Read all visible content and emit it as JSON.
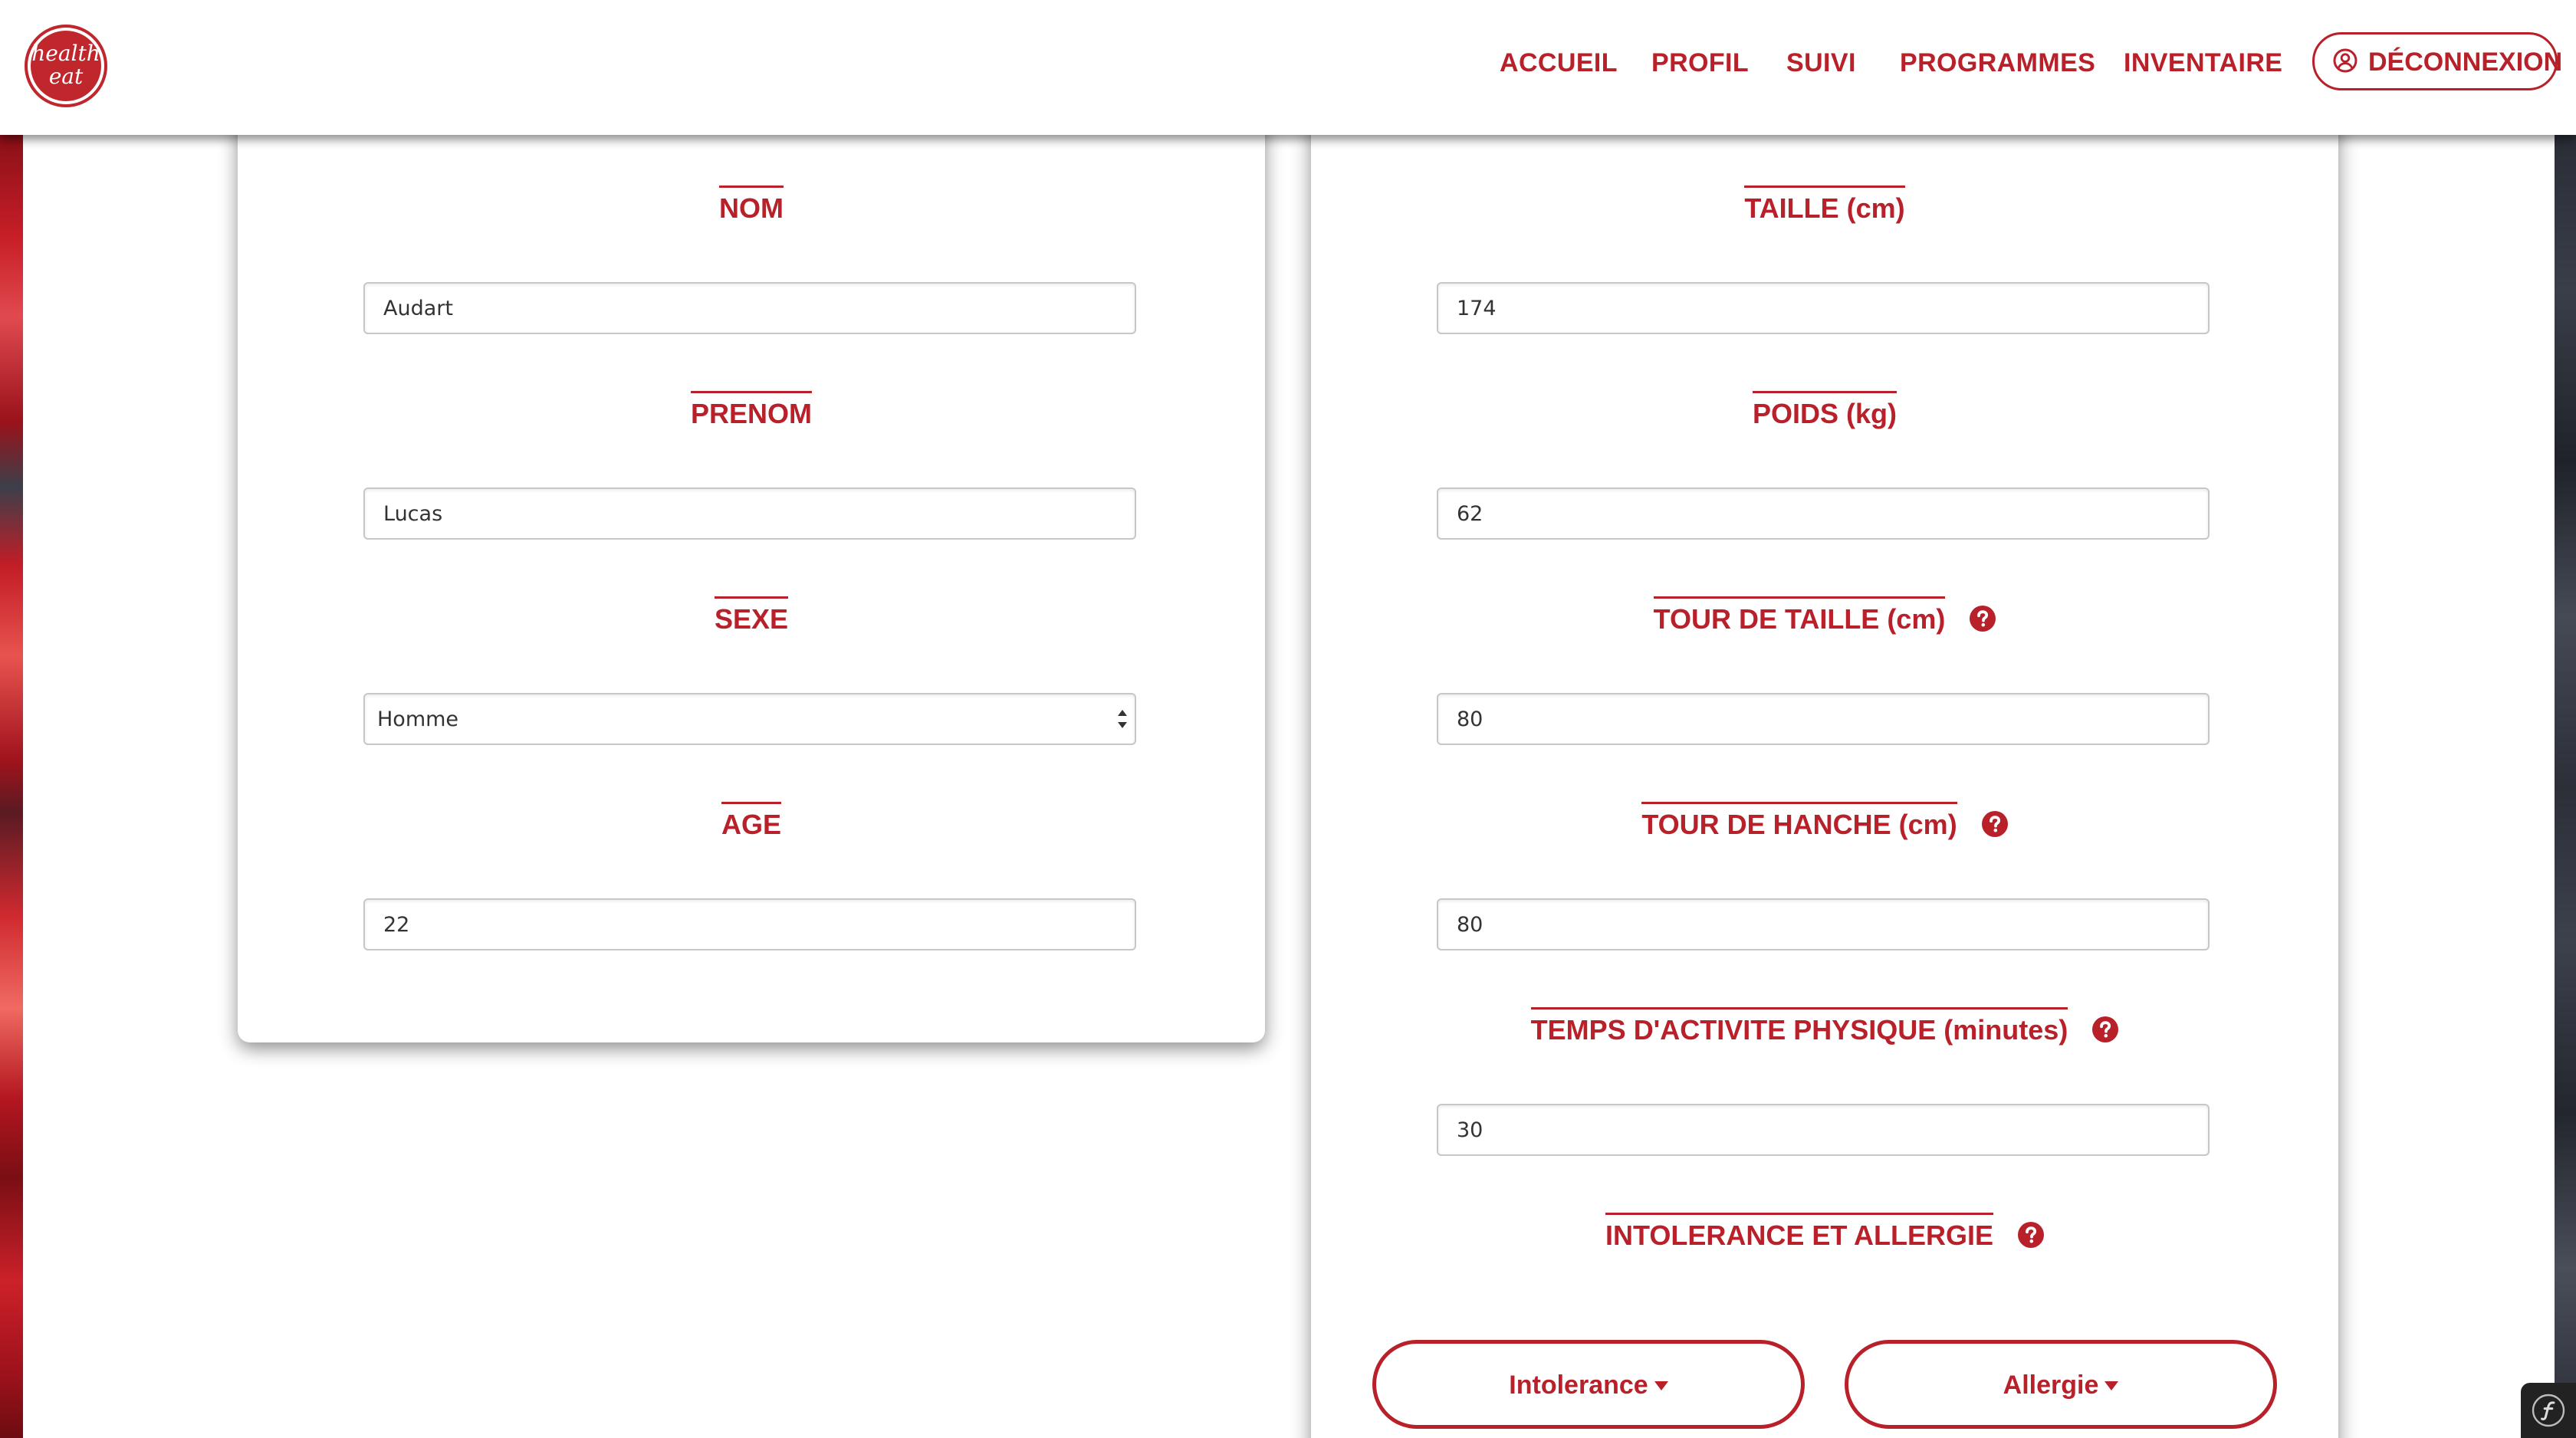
{
  "brand": {
    "logo_line1": "health",
    "logo_line2": "eat",
    "color": "#b8202a"
  },
  "nav": {
    "items": [
      {
        "label": "ACCUEIL"
      },
      {
        "label": "PROFIL"
      },
      {
        "label": "SUIVI"
      },
      {
        "label": "PROGRAMMES"
      },
      {
        "label": "INVENTAIRE"
      }
    ],
    "logout_label": "DÉCONNEXION",
    "logout_icon": "user-circle-icon"
  },
  "identity_form": {
    "nom": {
      "label": "NOM",
      "value": "Audart"
    },
    "prenom": {
      "label": "PRENOM",
      "value": "Lucas"
    },
    "sexe": {
      "label": "SEXE",
      "value": "Homme"
    },
    "age": {
      "label": "AGE",
      "value": "22"
    }
  },
  "body_form": {
    "taille": {
      "label": "TAILLE (cm)",
      "value": "174"
    },
    "poids": {
      "label": "POIDS (kg)",
      "value": "62"
    },
    "tour_taille": {
      "label": "TOUR DE TAILLE (cm)",
      "value": "80",
      "help_icon": "question-circle-icon"
    },
    "tour_hanche": {
      "label": "TOUR DE HANCHE (cm)",
      "value": "80",
      "help_icon": "question-circle-icon"
    },
    "activite": {
      "label": "TEMPS D'ACTIVITE PHYSIQUE (minutes)",
      "value": "30",
      "help_icon": "question-circle-icon"
    },
    "intolerance_allergie": {
      "label": "INTOLERANCE ET ALLERGIE",
      "help_icon": "question-circle-icon"
    }
  },
  "buttons": {
    "intolerance": "Intolerance",
    "allergie": "Allergie"
  },
  "debug_toolbar_icon": "symfony-icon"
}
